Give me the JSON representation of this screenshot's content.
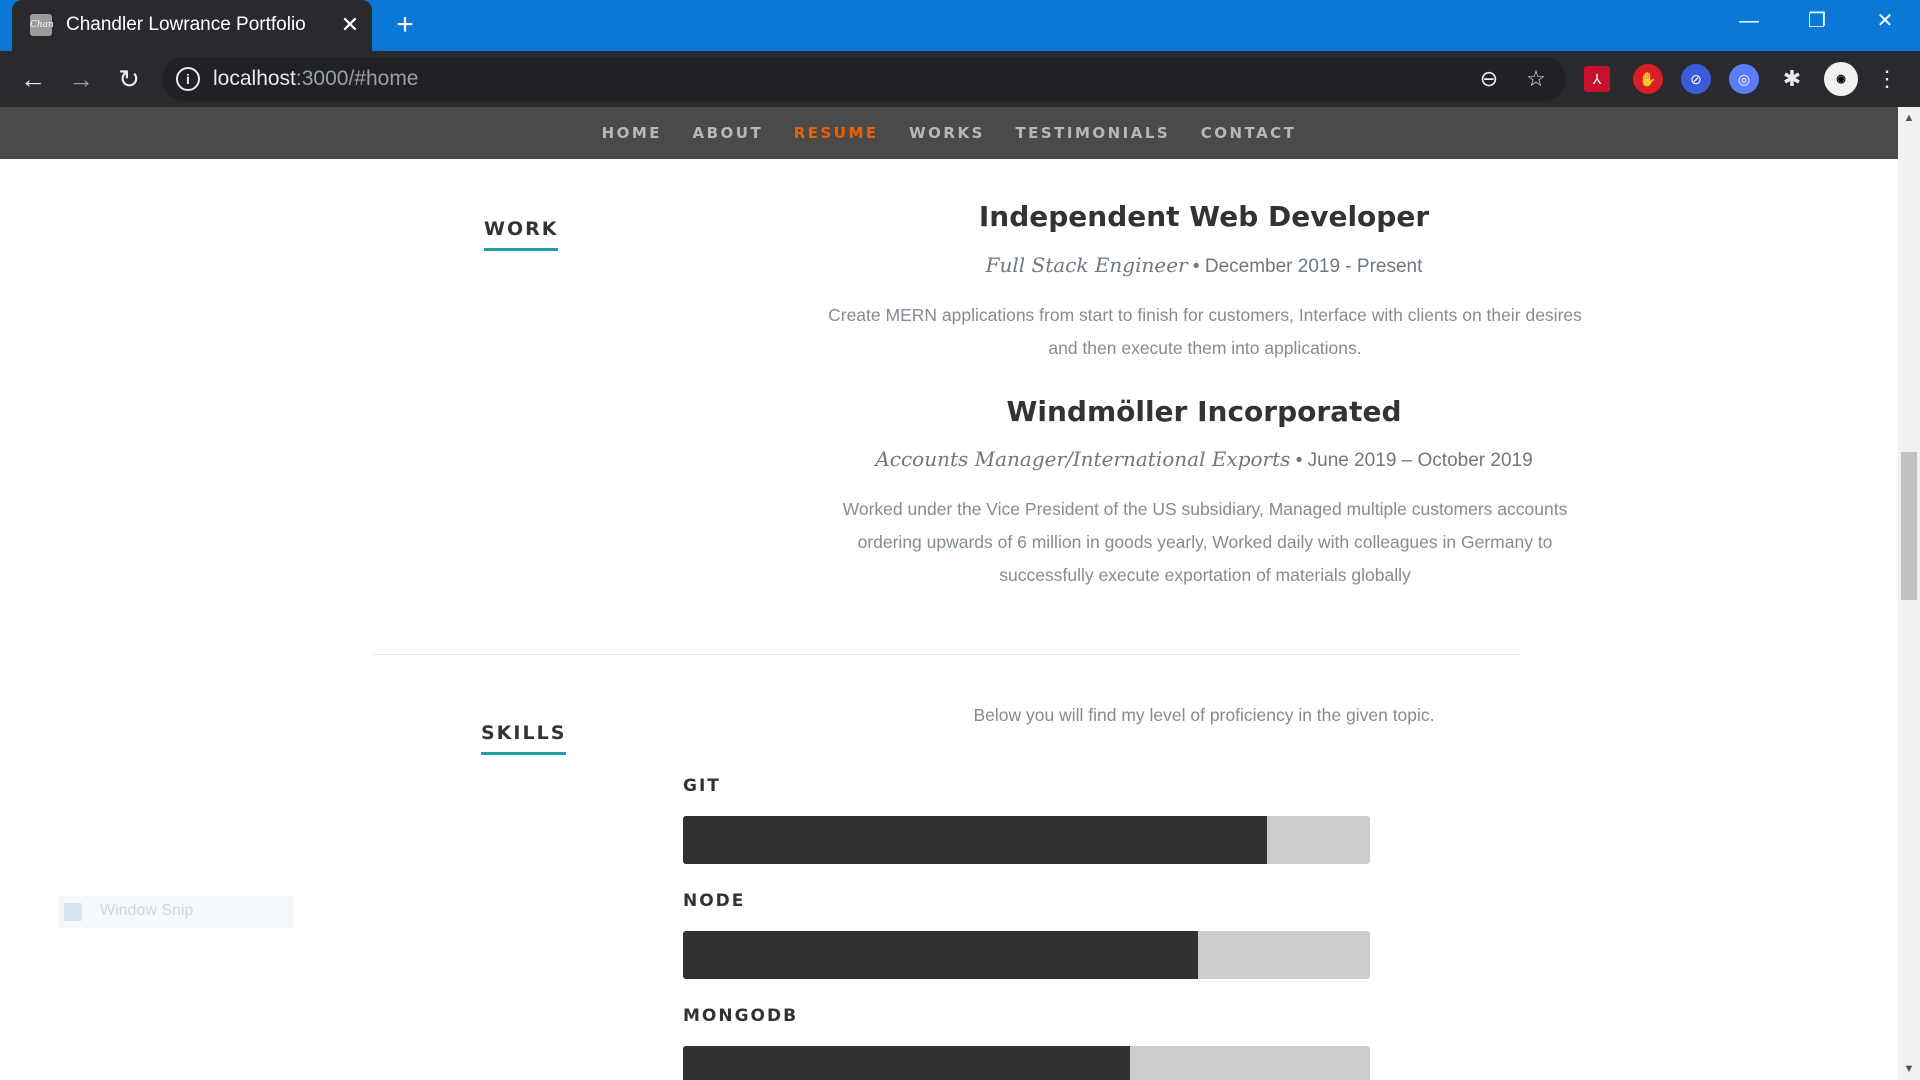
{
  "browser": {
    "tab_title": "Chandler Lowrance Portfolio",
    "favicon_text": "Chan",
    "url_host": "localhost",
    "url_rest": ":3000/#home",
    "icons": [
      "back-icon",
      "forward-icon",
      "reload-icon",
      "info-icon",
      "zoom-out-icon",
      "star-icon",
      "extensions-icon",
      "menu-icon"
    ],
    "accent_color": "#0a78d7"
  },
  "site_nav": {
    "items": [
      {
        "label": "HOME"
      },
      {
        "label": "ABOUT"
      },
      {
        "label": "RESUME"
      },
      {
        "label": "WORKS"
      },
      {
        "label": "TESTIMONIALS"
      },
      {
        "label": "CONTACT"
      }
    ],
    "active": "RESUME",
    "active_color": "#f06000"
  },
  "work": {
    "heading": "WORK",
    "jobs": [
      {
        "company": "Independent Web Developer",
        "role": "Full Stack Engineer",
        "dates": "December 2019 - Present",
        "description_lines": [
          "Create MERN applications from start to finish for customers, Interface with clients on their desires",
          "and then execute them into applications."
        ]
      },
      {
        "company": "Windmöller Incorporated",
        "role": "Accounts Manager/International Exports",
        "dates": "June 2019 – October 2019",
        "description_lines": [
          "Worked under the Vice President of the US subsidiary, Managed multiple customers accounts",
          "ordering upwards of 6 million in goods yearly, Worked daily with colleagues in Germany to",
          "successfully execute exportation of materials globally"
        ]
      }
    ]
  },
  "skills": {
    "heading": "SKILLS",
    "intro": "Below you will find my level of proficiency in the given topic.",
    "items": [
      {
        "name": "GIT",
        "level_percent": 85
      },
      {
        "name": "NODE",
        "level_percent": 75
      },
      {
        "name": "MONGODB",
        "level_percent": 65
      }
    ],
    "accent_color": "#1f9fa6"
  },
  "overlay": {
    "window_snip_label": "Window Snip"
  }
}
